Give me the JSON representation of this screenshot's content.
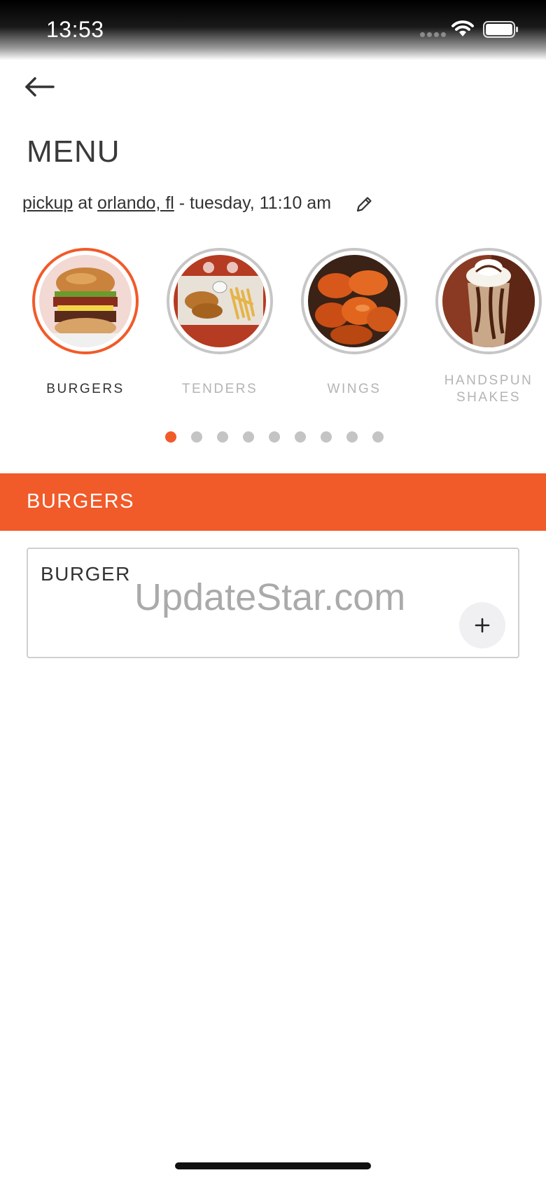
{
  "status_bar": {
    "time": "13:53",
    "icons": [
      "signal-icon",
      "wifi-icon",
      "battery-icon"
    ]
  },
  "header": {
    "back_icon": "arrow-left-icon",
    "title": "MENU"
  },
  "order_info": {
    "mode": "pickup",
    "connector": "at",
    "location": "orlando, fl",
    "datetime": "- tuesday, 11:10 am",
    "edit_icon": "pencil-icon"
  },
  "categories": [
    {
      "label": "BURGERS",
      "active": true
    },
    {
      "label": "TENDERS",
      "active": false
    },
    {
      "label": "WINGS",
      "active": false
    },
    {
      "label": "HANDSPUN SHAKES",
      "active": false
    }
  ],
  "pagination": {
    "total": 9,
    "current": 1
  },
  "section": {
    "title": "BURGERS"
  },
  "items": [
    {
      "name": "BURGER",
      "add_icon": "plus-icon"
    }
  ],
  "watermark": "UpdateStar.com",
  "colors": {
    "accent": "#f15a29",
    "inactive_border": "#c6c6c6",
    "text": "#333333",
    "inactive_text": "#b4b4b4"
  }
}
